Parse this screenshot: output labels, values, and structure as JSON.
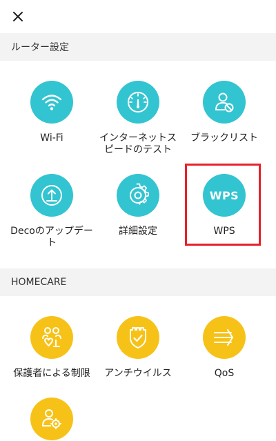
{
  "header": {
    "close_icon": "close-icon"
  },
  "sections": [
    {
      "title": "ルーター設定",
      "items": [
        {
          "label": "Wi-Fi",
          "icon": "wifi-icon"
        },
        {
          "label": "インターネットスピードのテスト",
          "icon": "speedometer-icon"
        },
        {
          "label": "ブラックリスト",
          "icon": "user-block-icon"
        },
        {
          "label": "Decoのアップデート",
          "icon": "upload-icon"
        },
        {
          "label": "詳細設定",
          "icon": "gear-icon"
        },
        {
          "label": "WPS",
          "icon_text": "WPS"
        }
      ]
    },
    {
      "title": "HOMECARE",
      "items": [
        {
          "label": "保護者による制限",
          "icon": "parental-control-icon"
        },
        {
          "label": "アンチウイルス",
          "icon": "shield-icon"
        },
        {
          "label": "QoS",
          "icon": "qos-icon"
        },
        {
          "label": "",
          "icon": "user-settings-icon"
        }
      ]
    }
  ],
  "colors": {
    "teal": "#33c4d1",
    "gold": "#f7c218",
    "highlight": "#e8202a",
    "section_bg": "#f3f3f3"
  }
}
